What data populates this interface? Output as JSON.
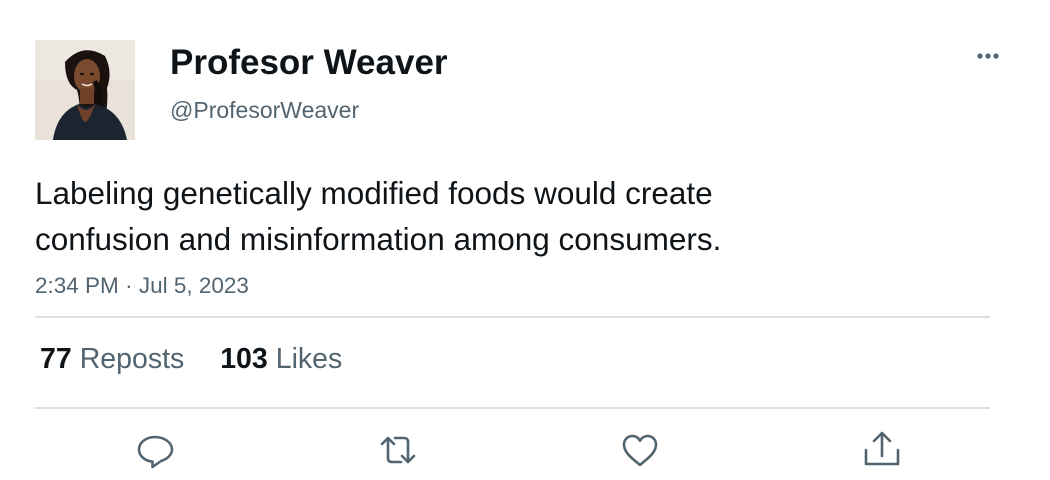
{
  "tweet": {
    "display_name": "Profesor Weaver",
    "handle": "@ProfesorWeaver",
    "text_lines": [
      "Labeling genetically modified foods would create",
      "confusion and misinformation among consumers."
    ],
    "time": "2:34 PM",
    "separator": "·",
    "date": "Jul 5, 2023"
  },
  "stats": {
    "reposts_count": "77",
    "reposts_label": "Reposts",
    "likes_count": "103",
    "likes_label": "Likes"
  },
  "icons": {
    "more": "more-horizontal-icon",
    "reply": "reply-icon",
    "repost": "repost-icon",
    "like": "heart-icon",
    "share": "share-icon"
  },
  "colors": {
    "text": "#0f1419",
    "secondary_text": "#536471",
    "divider": "#dadfe3",
    "icon": "#536471"
  }
}
